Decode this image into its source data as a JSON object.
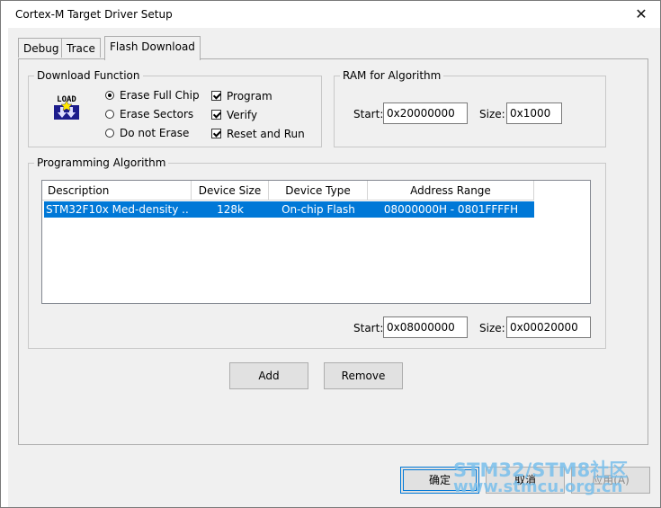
{
  "window": {
    "title": "Cortex-M Target Driver Setup"
  },
  "tabs": [
    {
      "label": "Debug"
    },
    {
      "label": "Trace"
    },
    {
      "label": "Flash Download"
    }
  ],
  "download_function": {
    "legend": "Download Function",
    "icon_text": "LOAD",
    "radios": [
      {
        "label": "Erase Full Chip",
        "selected": true
      },
      {
        "label": "Erase Sectors",
        "selected": false
      },
      {
        "label": "Do not Erase",
        "selected": false
      }
    ],
    "checks": [
      {
        "label": "Program",
        "checked": true
      },
      {
        "label": "Verify",
        "checked": true
      },
      {
        "label": "Reset and Run",
        "checked": true
      }
    ]
  },
  "ram": {
    "legend": "RAM for Algorithm",
    "start_label": "Start:",
    "start_value": "0x20000000",
    "size_label": "Size:",
    "size_value": "0x1000"
  },
  "algorithm": {
    "legend": "Programming Algorithm",
    "columns": [
      "Description",
      "Device Size",
      "Device Type",
      "Address Range"
    ],
    "rows": [
      {
        "description": "STM32F10x Med-density ...",
        "size": "128k",
        "type": "On-chip Flash",
        "range": "08000000H - 0801FFFFH"
      }
    ],
    "start_label": "Start:",
    "start_value": "0x08000000",
    "size_label": "Size:",
    "size_value": "0x00020000"
  },
  "buttons": {
    "add": "Add",
    "remove": "Remove",
    "ok": "确定",
    "cancel": "取消",
    "apply": "应用(A)"
  },
  "watermark": {
    "line1": "STM32/STM8社区",
    "line2": "www.stmcu.org.cn"
  },
  "colors": {
    "selection": "#0078d7",
    "window_bg": "#f0f0f0"
  }
}
